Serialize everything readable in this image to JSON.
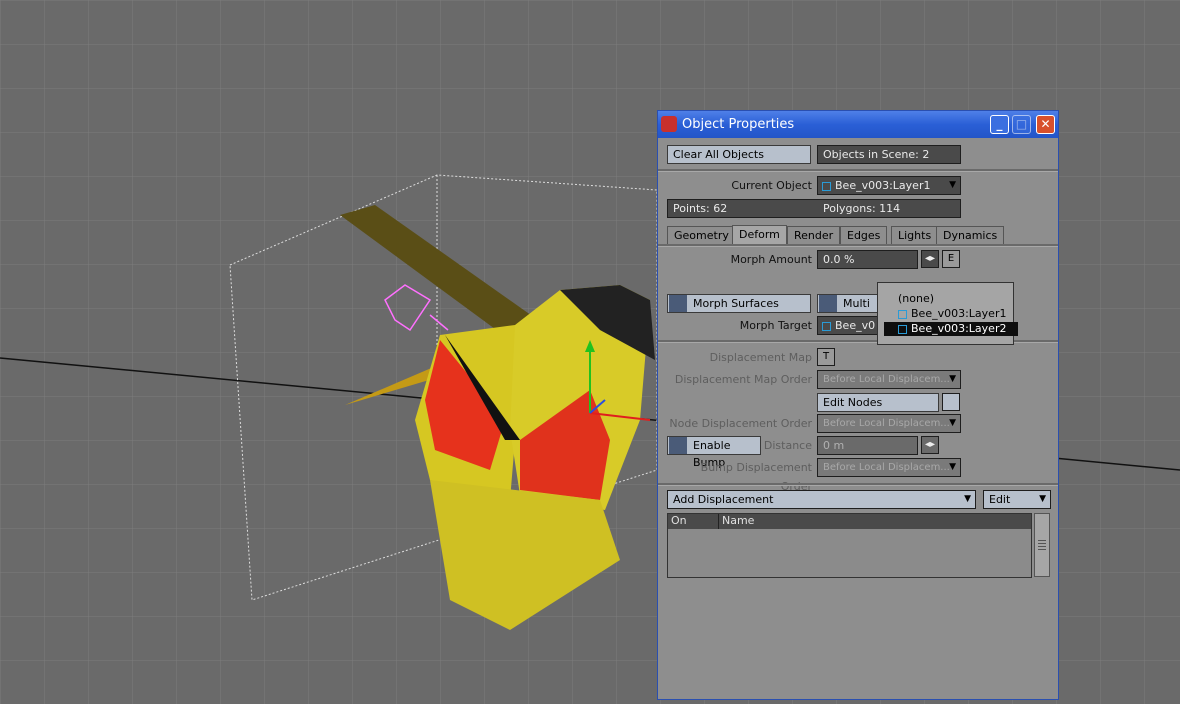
{
  "window": {
    "title": "Object Properties"
  },
  "top": {
    "clear_all": "Clear All Objects",
    "objects_in_scene": "Objects in Scene: 2"
  },
  "object": {
    "current_object_label": "Current Object",
    "current_object_value": "Bee_v003:Layer1",
    "points": "Points: 62",
    "polygons": "Polygons: 114"
  },
  "tabs": [
    {
      "label": "Geometry"
    },
    {
      "label": "Deform"
    },
    {
      "label": "Render"
    },
    {
      "label": "Edges"
    },
    {
      "label": "Lights"
    },
    {
      "label": "Dynamics"
    }
  ],
  "deform": {
    "morph_amount_label": "Morph Amount",
    "morph_amount_value": "0.0 %",
    "envelope_btn": "E",
    "morph_surfaces": "Morph Surfaces",
    "multi_target": "Multi T",
    "morph_target_label": "Morph Target",
    "morph_target_value": "Bee_v0",
    "displacement_map_label": "Displacement Map",
    "displacement_map_btn": "T",
    "displacement_map_order_label": "Displacement Map Order",
    "displacement_map_order_value": "Before Local Displacem...",
    "edit_nodes": "Edit Nodes",
    "node_displacement_order_label": "Node Displacement Order",
    "node_displacement_order_value": "Before Local Displacem...",
    "enable_bump": "Enable Bump",
    "distance_label": "Distance",
    "distance_value": "0 m",
    "bump_displacement_order_label": "Bump Displacement Order",
    "bump_displacement_order_value": "Before Local Displacem...",
    "add_displacement": "Add Displacement",
    "edit": "Edit",
    "col_on": "On",
    "col_name": "Name"
  },
  "popup": {
    "items": [
      "(none)",
      "Bee_v003:Layer1",
      "Bee_v003:Layer2"
    ]
  },
  "colors": {
    "accent": "#2a5fd6",
    "panel": "#8e8e8e",
    "field": "#4a4a4a"
  }
}
